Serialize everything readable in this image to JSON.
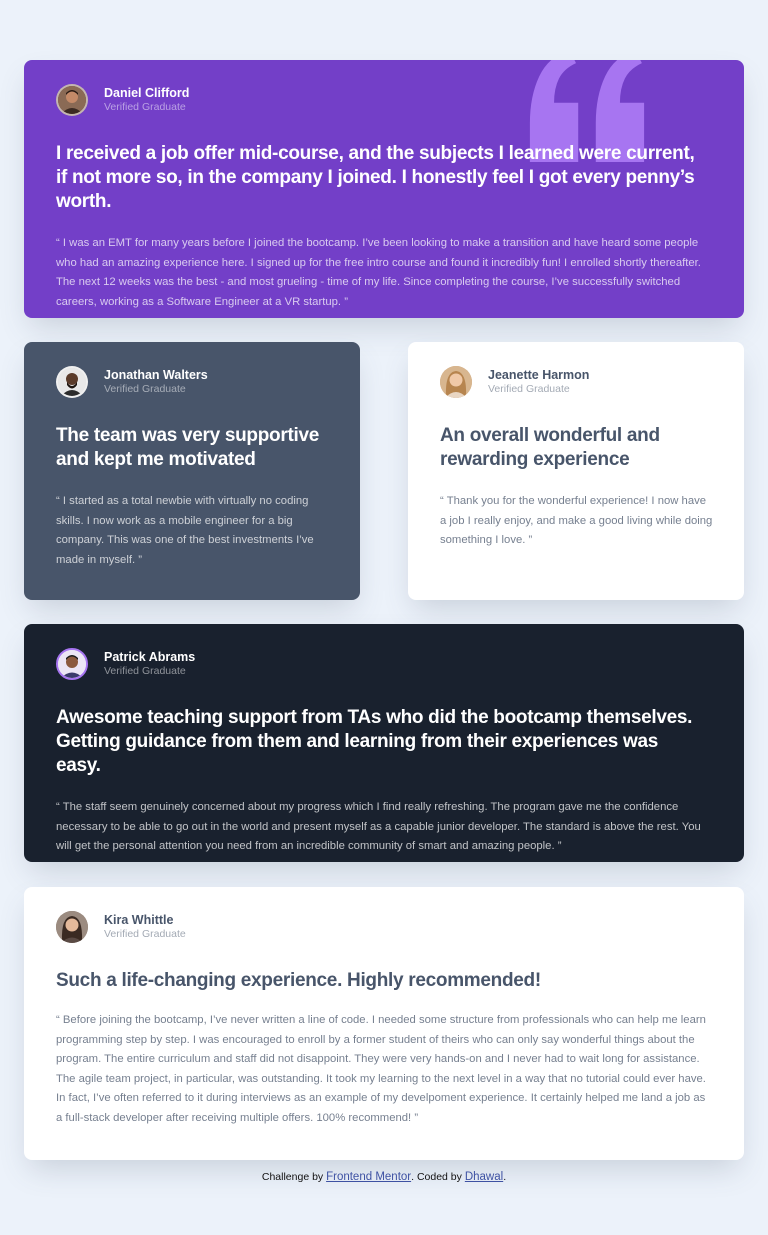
{
  "testimonials": [
    {
      "name": "Daniel Clifford",
      "role": "Verified Graduate",
      "headline": "I received a job offer mid-course, and the subjects I learned were current, if not more so, in the company I joined. I honestly feel I got every penny’s worth.",
      "quote": "“ I was an EMT for many years before I joined the bootcamp. I’ve been looking to make a transition and have heard some people who had an amazing experience here. I signed up for the free intro course and found it incredibly fun! I enrolled shortly thereafter. The next 12 weeks was the best - and most grueling - time of my life. Since completing the course, I’ve successfully switched careers, working as a Software Engineer at a VR startup. ”"
    },
    {
      "name": "Jonathan Walters",
      "role": "Verified Graduate",
      "headline": "The team was very supportive and kept me motivated",
      "quote": "“ I started as a total newbie with virtually no coding skills. I now work as a mobile engineer for a big company. This was one of the best investments I’ve made in myself. ”"
    },
    {
      "name": "Jeanette Harmon",
      "role": "Verified Graduate",
      "headline": "An overall wonderful and rewarding experience",
      "quote": "“ Thank you for the wonderful experience! I now have a job I really enjoy, and make a good living while doing something I love. ”"
    },
    {
      "name": "Patrick Abrams",
      "role": "Verified Graduate",
      "headline": "Awesome teaching support from TAs who did the bootcamp themselves. Getting guidance from them and learning from their experiences was easy.",
      "quote": "“ The staff seem genuinely concerned about my progress which I find really refreshing. The program gave me the confidence necessary to be able to go out in the world and present myself as a capable junior developer. The standard is above the rest. You will get the personal attention you need from an incredible community of smart and amazing people. ”"
    },
    {
      "name": "Kira Whittle",
      "role": "Verified Graduate",
      "headline": "Such a life-changing experience. Highly recommended!",
      "quote": "“ Before joining the bootcamp, I’ve never written a line of code. I needed some structure from professionals who can help me learn programming step by step. I was encouraged to enroll by a former student of theirs who can only say wonderful things about the program. The entire curriculum and staff did not disappoint. They were very hands-on and I never had to wait long for assistance. The agile team project, in particular, was outstanding. It took my learning to the next level in a way that no tutorial could ever have. In fact, I’ve often referred to it during interviews as an example of my develpoment experience. It certainly helped me land a job as a full-stack developer after receiving multiple offers. 100% recommend! ”"
    }
  ],
  "footer": {
    "prefix": "Challenge by",
    "link1": "Frontend Mentor",
    "middle": ". Coded by",
    "link2": "Dhawal",
    "suffix": "."
  },
  "colors": {
    "purple": "#733fc8",
    "gray_blue": "#48556a",
    "white": "#ffffff",
    "dark_blue": "#19212e",
    "background": "#ecf2fa"
  }
}
